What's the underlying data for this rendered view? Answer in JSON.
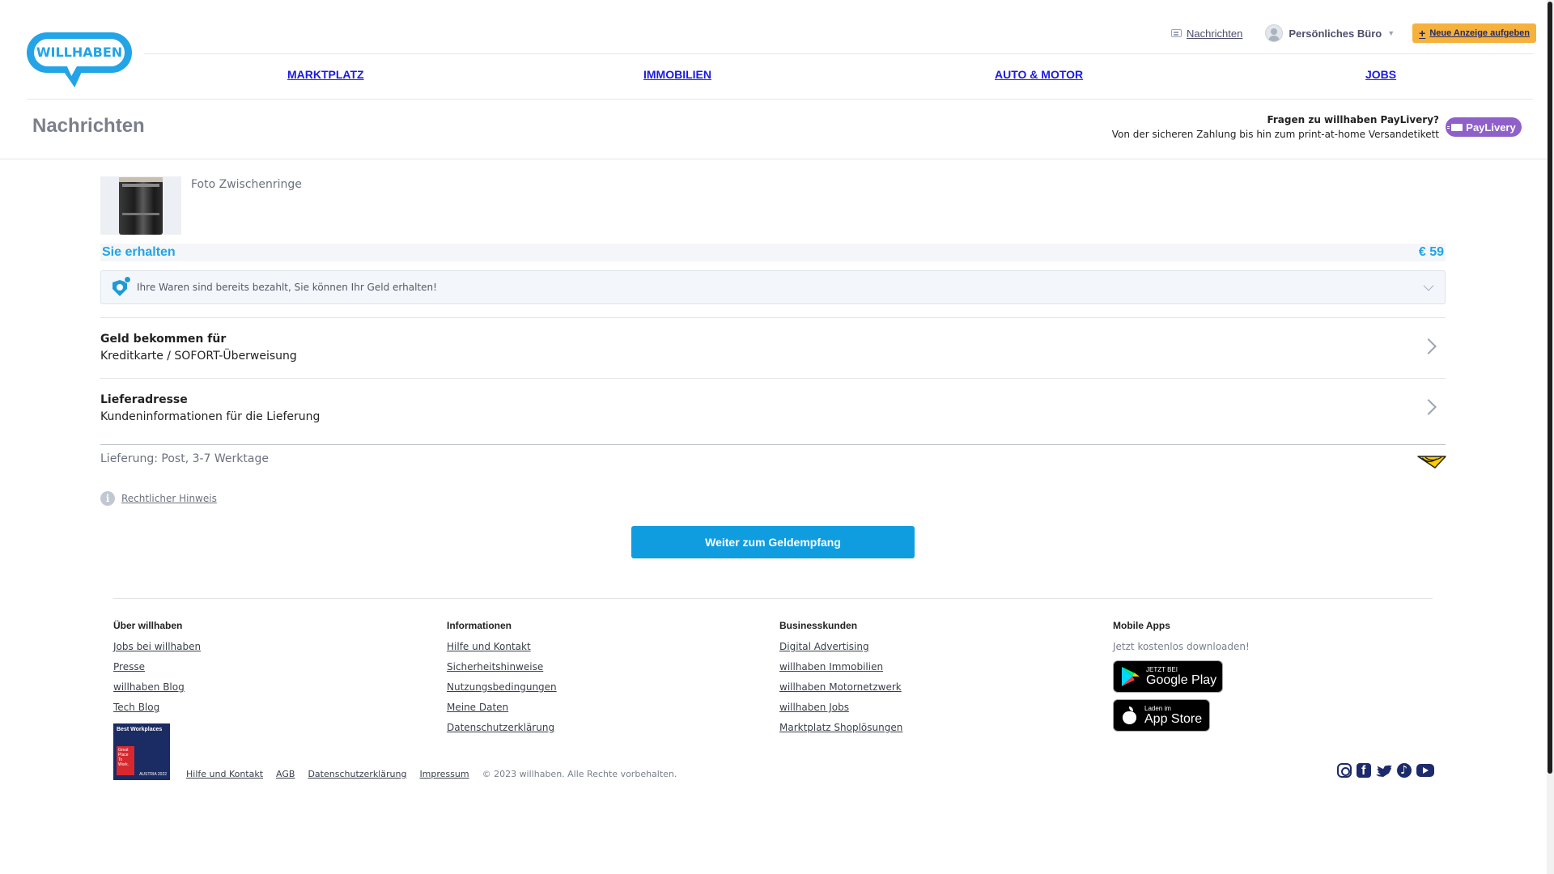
{
  "header": {
    "logo_text": "WILLHABEN",
    "nachrichten_link": "Nachrichten",
    "buero_label": "Persönliches Büro",
    "new_ad_label": "Neue Anzeige aufgeben",
    "nav": [
      "MARKTPLATZ",
      "IMMOBILIEN",
      "AUTO & MOTOR",
      "JOBS"
    ],
    "accent_color": "#22a4e6",
    "nav_color": "#1a1ae6"
  },
  "page": {
    "title": "Nachrichten",
    "paylivery_question": "Fragen zu willhaben PayLivery?",
    "paylivery_sub": "Von der sicheren Zahlung bis hin zum print-at-home Versandetikett",
    "paylivery_button": "PayLivery",
    "paylivery_color": "#8f60c9"
  },
  "product": {
    "name": "Foto Zwischenringe",
    "receive_label": "Sie erhalten",
    "price": "€ 59"
  },
  "info_box": {
    "text": "Ihre Waren sind bereits bezahlt, Sie können Ihr Geld erhalten!"
  },
  "rows": [
    {
      "title": "Geld bekommen für",
      "subtitle": "Kreditkarte / SOFORT-Überweisung"
    },
    {
      "title": "Lieferadresse",
      "subtitle": "Kundeninformationen für die Lieferung"
    }
  ],
  "delivery": {
    "text": "Lieferung: Post, 3-7 Werktage",
    "post_logo_color": "#ffcc00"
  },
  "legal_link": "Rechtlicher Hinweis",
  "cta_label": "Weiter zum Geldempfang",
  "footer": {
    "col1": {
      "heading": "Über willhaben",
      "links": [
        "Jobs bei willhaben",
        "Presse",
        "willhaben Blog",
        "Tech Blog"
      ]
    },
    "col2": {
      "heading": "Informationen",
      "links": [
        "Hilfe und Kontakt",
        "Sicherheitshinweise",
        "Nutzungsbedingungen",
        "Meine Daten",
        "Datenschutzerklärung"
      ]
    },
    "col3": {
      "heading": "Businesskunden",
      "links": [
        "Digital Advertising",
        "willhaben Immobilien",
        "willhaben Motornetzwerk",
        "willhaben Jobs",
        "Marktplatz Shoplösungen"
      ]
    },
    "col4": {
      "heading": "Mobile Apps",
      "text": "Jetzt kostenlos downloaden!",
      "google_small": "JETZT BEI",
      "google_big": "Google Play",
      "apple_small": "Laden im",
      "apple_big": "App Store"
    },
    "badge": {
      "title": "Best Workplaces",
      "red_text": "Great Place To Work.",
      "year": "AUSTRIA 2022"
    },
    "bottom_links": [
      "Hilfe und Kontakt",
      "AGB",
      "Datenschutzerklärung",
      "Impressum"
    ],
    "copyright": "© 2023 willhaben. Alle Rechte vorbehalten.",
    "socials": [
      "instagram-icon",
      "facebook-icon",
      "twitter-icon",
      "tiktok-icon",
      "youtube-icon"
    ]
  }
}
